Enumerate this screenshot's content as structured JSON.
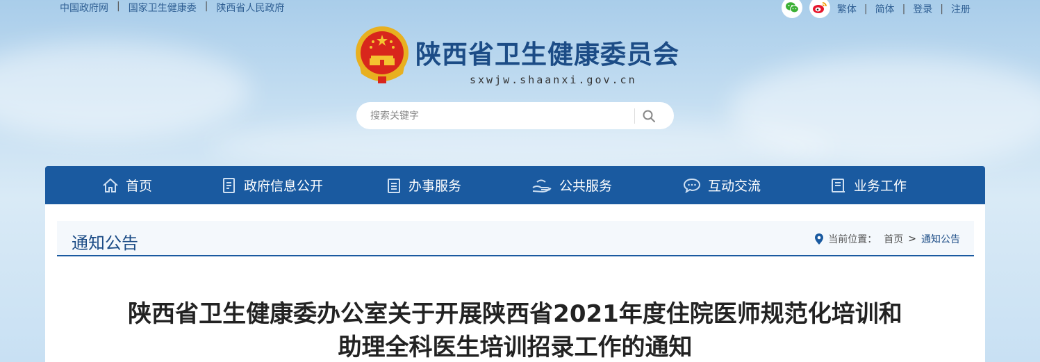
{
  "topbar": {
    "links": [
      "中国政府网",
      "国家卫生健康委",
      "陕西省人民政府"
    ],
    "separator": "|",
    "right_links": [
      "繁体",
      "简体",
      "登录",
      "注册"
    ],
    "social_icons": [
      "wechat-icon",
      "weibo-icon"
    ]
  },
  "header": {
    "site_name": "陕西省卫生健康委员会",
    "domain": "sxwjw.shaanxi.gov.cn"
  },
  "search": {
    "placeholder": "搜索关键字"
  },
  "nav": {
    "items": [
      {
        "label": "首页",
        "icon": "home-icon"
      },
      {
        "label": "政府信息公开",
        "icon": "document-icon"
      },
      {
        "label": "办事服务",
        "icon": "clipboard-icon"
      },
      {
        "label": "公共服务",
        "icon": "hand-service-icon"
      },
      {
        "label": "互动交流",
        "icon": "chat-icon"
      },
      {
        "label": "业务工作",
        "icon": "briefcase-icon"
      }
    ]
  },
  "section": {
    "title": "通知公告"
  },
  "breadcrumb": {
    "label": "当前位置：",
    "home": "首页",
    "sep": ">",
    "current": "通知公告"
  },
  "article": {
    "title_line1": "陕西省卫生健康委办公室关于开展陕西省2021年度住院医师规范化培训和",
    "title_line2": "助理全科医生培训招录工作的通知"
  },
  "colors": {
    "nav_bg": "#1a5aa0",
    "title_blue": "#1c4c86",
    "link_blue": "#2f5f93"
  }
}
